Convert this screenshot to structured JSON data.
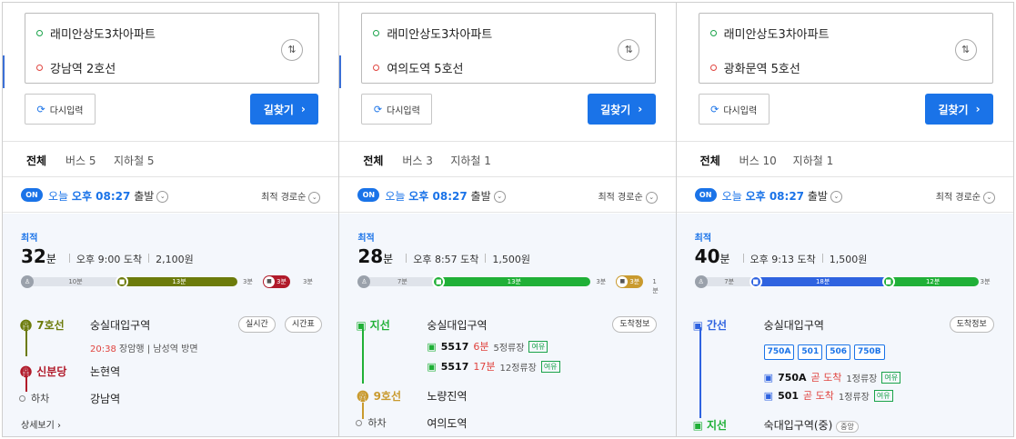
{
  "colors": {
    "accent": "#1a73e8",
    "line7": "#6c7b0b",
    "sinbundang": "#b11a2a",
    "line9": "#c99a2e",
    "line5": "#8b43c9",
    "green_bus": "#20b037",
    "blue_bus": "#2f63e0"
  },
  "panels": [
    {
      "origin": "래미안상도3차아파트",
      "destination": "강남역 2호선",
      "reset_label": "다시입력",
      "go_label": "길찾기",
      "tabs": [
        {
          "label": "전체"
        },
        {
          "label": "버스 5"
        },
        {
          "label": "지하철 5"
        }
      ],
      "on": "ON",
      "dep_day": "오늘",
      "dep_time": "오후 08:27",
      "dep_label": "출발",
      "sort": "최적 경로순",
      "best": "최적",
      "minutes": "32",
      "min_unit": "분",
      "arrive": "오후 9:00 도착",
      "fare": "2,100원",
      "bar": {
        "walk1": "10분",
        "ride1": "13분",
        "walk2": "3분",
        "ride2": "3분",
        "walk3": "3분"
      },
      "steps": {
        "s1_line": "7호선",
        "s1_station": "숭실대입구역",
        "s1_chip1": "실시간",
        "s1_chip2": "시간표",
        "s1_time": "20:38",
        "s1_dir": "장암행",
        "s1_door": "남성역 방면",
        "s2_line": "신분당",
        "s2_station": "논현역",
        "s3_line": "하차",
        "s3_station": "강남역",
        "detail": "상세보기"
      }
    },
    {
      "origin": "래미안상도3차아파트",
      "destination": "여의도역 5호선",
      "reset_label": "다시입력",
      "go_label": "길찾기",
      "tabs": [
        {
          "label": "전체"
        },
        {
          "label": "버스 3"
        },
        {
          "label": "지하철 1"
        }
      ],
      "on": "ON",
      "dep_day": "오늘",
      "dep_time": "오후 08:27",
      "dep_label": "출발",
      "sort": "최적 경로순",
      "best": "최적",
      "minutes": "28",
      "min_unit": "분",
      "arrive": "오후 8:57 도착",
      "fare": "1,500원",
      "bar": {
        "walk1": "7분",
        "ride1": "13분",
        "walk2": "3분",
        "ride2": "3분",
        "walk3": "1분"
      },
      "steps": {
        "s1_line": "지선",
        "s1_station": "숭실대입구역",
        "s1_chip": "도착정보",
        "bus1": "5517",
        "bus1_eta": "6분",
        "bus1_stops": "5정류장",
        "bus1_tag": "여유",
        "bus2": "5517",
        "bus2_eta": "17분",
        "bus2_stops": "12정류장",
        "bus2_tag": "여유",
        "s2_line": "9호선",
        "s2_station": "노량진역",
        "s3_line": "하차",
        "s3_station": "여의도역"
      }
    },
    {
      "origin": "래미안상도3차아파트",
      "destination": "광화문역 5호선",
      "reset_label": "다시입력",
      "go_label": "길찾기",
      "tabs": [
        {
          "label": "전체"
        },
        {
          "label": "버스 10"
        },
        {
          "label": "지하철 1"
        }
      ],
      "on": "ON",
      "dep_day": "오늘",
      "dep_time": "오후 08:27",
      "dep_label": "출발",
      "sort": "최적 경로순",
      "best": "최적",
      "minutes": "40",
      "min_unit": "분",
      "arrive": "오후 9:13 도착",
      "fare": "1,500원",
      "bar": {
        "walk1": "7분",
        "ride1": "18분",
        "ride2": "12분",
        "walk3": "3분"
      },
      "steps": {
        "s1_line": "간선",
        "s1_station": "숭실대입구역",
        "s1_chip": "도착정보",
        "routes": [
          "750A",
          "501",
          "506",
          "750B"
        ],
        "bus1": "750A",
        "bus1_eta": "곧 도착",
        "bus1_stops": "1정류장",
        "bus1_tag": "여유",
        "bus2": "501",
        "bus2_eta": "곧 도착",
        "bus2_stops": "1정류장",
        "bus2_tag": "여유",
        "s2_line": "지선",
        "s2_station": "숙대입구역(중)",
        "s2_badge": "중앙"
      }
    }
  ]
}
